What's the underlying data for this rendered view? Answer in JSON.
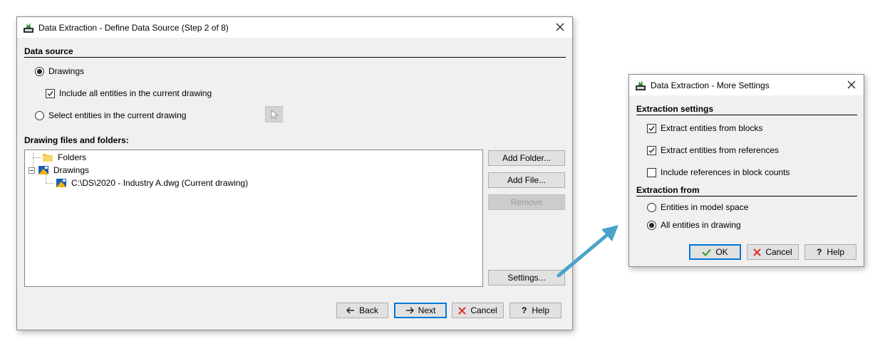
{
  "main_dialog": {
    "title": "Data Extraction - Define Data Source (Step 2 of 8)",
    "data_source_heading": "Data source",
    "radio_drawings": "Drawings",
    "check_include_all": "Include all entities in the current drawing",
    "radio_select_entities": "Select entities in the current drawing",
    "files_heading": "Drawing files and folders:",
    "tree": {
      "folders": "Folders",
      "drawings": "Drawings",
      "file": "C:\\DS\\2020 - Industry A.dwg (Current drawing)"
    },
    "buttons": {
      "add_folder": "Add Folder...",
      "add_file": "Add File...",
      "remove": "Remove",
      "settings": "Settings...",
      "back": "Back",
      "next": "Next",
      "cancel": "Cancel",
      "help": "Help"
    }
  },
  "settings_dialog": {
    "title": "Data Extraction - More Settings",
    "extraction_settings_heading": "Extraction settings",
    "check_blocks": "Extract entities from blocks",
    "check_references": "Extract entities from references",
    "check_block_counts": "Include references in block counts",
    "extraction_from_heading": "Extraction from",
    "radio_model_space": "Entities in model space",
    "radio_all_entities": "All entities in drawing",
    "buttons": {
      "ok": "OK",
      "cancel": "Cancel",
      "help": "Help"
    }
  },
  "colors": {
    "accent_blue": "#0078d7",
    "arrow": "#4aa3c8",
    "cancel_red": "#e03030",
    "ok_green": "#2e9e2e"
  }
}
